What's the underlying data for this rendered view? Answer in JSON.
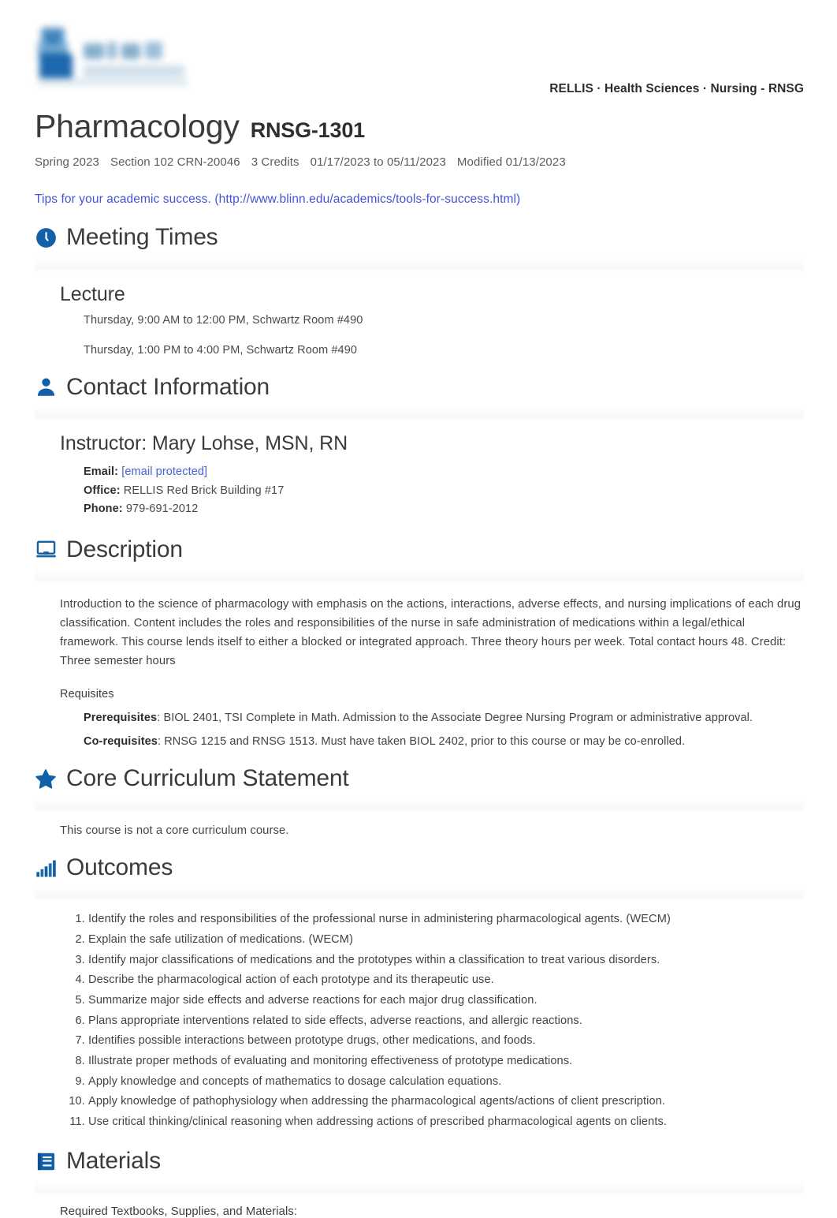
{
  "header": {
    "logo_alt": "Blinn College logo",
    "breadcrumb": "RELLIS · Health Sciences · Nursing - RNSG"
  },
  "course": {
    "title": "Pharmacology",
    "code": "RNSG-1301",
    "term": "Spring 2023",
    "section": "Section 102 CRN-20046",
    "credits": "3 Credits",
    "dates": "01/17/2023 to 05/11/2023",
    "modified": "Modified 01/13/2023"
  },
  "tips": {
    "text": "Tips for your academic success.",
    "url_display": "(http://www.blinn.edu/academics/tools-for-success.html)",
    "url": "http://www.blinn.edu/academics/tools-for-success.html"
  },
  "sections": {
    "meeting_times": {
      "icon": "clock-icon",
      "heading": "Meeting Times",
      "subheading": "Lecture",
      "entries": [
        "Thursday, 9:00 AM to 12:00 PM, Schwartz Room #490",
        "Thursday, 1:00 PM to 4:00 PM, Schwartz Room #490"
      ]
    },
    "contact": {
      "icon": "person-icon",
      "heading": "Contact Information",
      "instructor": "Instructor: Mary Lohse, MSN, RN",
      "email_label": "Email:",
      "email_value": "[email protected]",
      "office_label": "Office:",
      "office_value": "RELLIS Red Brick Building #17",
      "phone_label": "Phone:",
      "phone_value": "979-691-2012"
    },
    "description": {
      "icon": "monitor-icon",
      "heading": "Description",
      "body": "Introduction to the science of pharmacology with emphasis on the actions, interactions, adverse effects, and nursing implications of each drug classification. Content includes the roles and responsibilities of the nurse in safe administration of medications within a legal/ethical framework. This course lends itself to either a blocked or integrated approach. Three theory hours per week. Total contact hours 48. Credit: Three semester hours",
      "requisites_title": "Requisites",
      "prereq_label": "Prerequisites",
      "prereq_value": ": BIOL 2401, TSI Complete in Math. Admission to the Associate Degree Nursing Program or administrative approval.",
      "coreq_label": "Co-requisites",
      "coreq_value": ": RNSG 1215 and RNSG 1513. Must have taken BIOL 2402, prior to this course or may be co-enrolled."
    },
    "core_curriculum": {
      "icon": "star-icon",
      "heading": "Core Curriculum Statement",
      "body": "This course is not a core curriculum course."
    },
    "outcomes": {
      "icon": "bar-chart-icon",
      "heading": "Outcomes",
      "items": [
        "Identify the roles and responsibilities of the professional nurse in administering pharmacological agents. (WECM)",
        "Explain the safe utilization of medications. (WECM)",
        "Identify major classifications of medications and the prototypes within a classification to treat various disorders.",
        "Describe the pharmacological action of each prototype and its therapeutic use.",
        "Summarize major side effects and adverse reactions for each major drug classification.",
        "Plans appropriate interventions related to side effects, adverse reactions, and allergic reactions.",
        "Identifies possible interactions between prototype drugs, other medications, and foods.",
        "Illustrate proper methods of evaluating and monitoring effectiveness of prototype medications.",
        "Apply knowledge and concepts of mathematics to dosage calculation equations.",
        "Apply knowledge of pathophysiology when addressing the pharmacological agents/actions of client prescription.",
        "Use critical thinking/clinical reasoning when addressing actions of prescribed pharmacological agents on clients."
      ]
    },
    "materials": {
      "icon": "book-icon",
      "heading": "Materials",
      "body": "Required Textbooks, Supplies, and Materials:"
    }
  },
  "colors": {
    "icon_blue": "#1161a8",
    "link_blue": "#4455d6",
    "text": "#3c3c3c"
  }
}
